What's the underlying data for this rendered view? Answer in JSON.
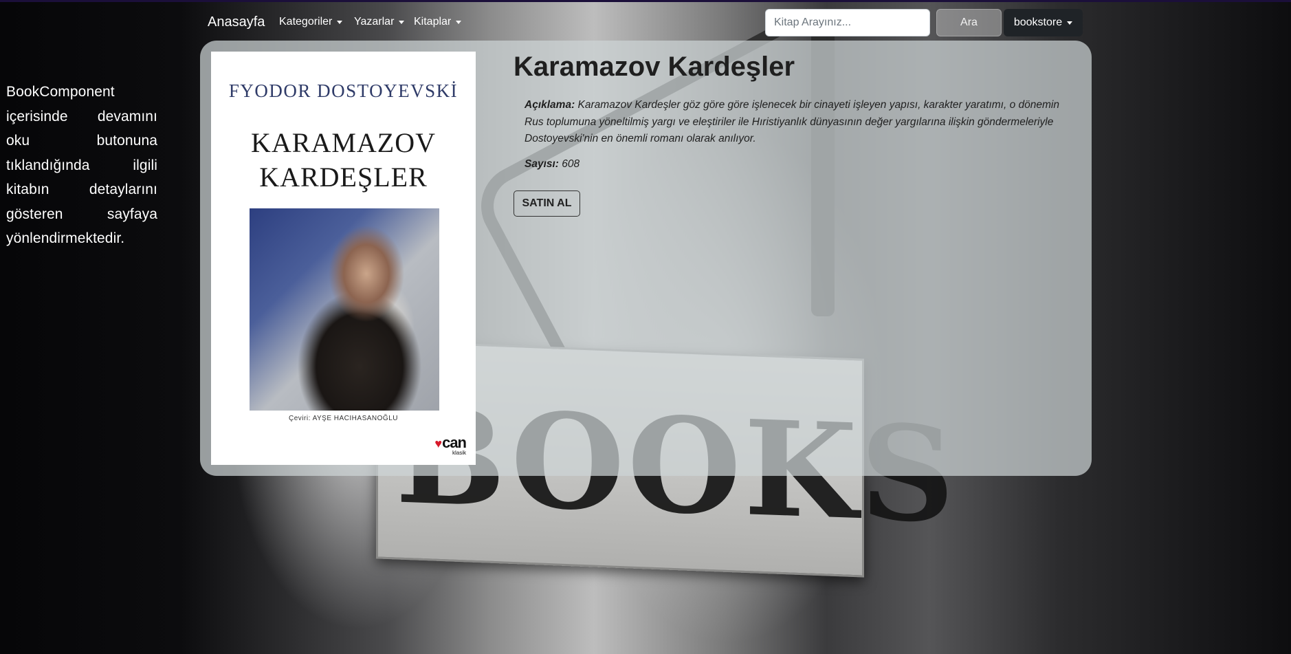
{
  "navbar": {
    "brand": "Anasayfa",
    "links": [
      {
        "label": "Kategoriler"
      },
      {
        "label": "Yazarlar"
      },
      {
        "label": "Kitaplar"
      }
    ],
    "search_placeholder": "Kitap Arayınız...",
    "search_button": "Ara",
    "user_menu": "bookstore"
  },
  "side_note": "BookComponent içerisinde devamını oku butonuna tıklandığında ilgili kitabın detaylarını gösteren sayfaya yönlendirmektedir.",
  "book": {
    "cover": {
      "author": "FYODOR DOSTOYEVSKİ",
      "title_line1": "KARAMAZOV",
      "title_line2": "KARDEŞLER",
      "translator": "Çeviri: AYŞE HACIHASANOĞLU",
      "publisher": "can",
      "series": "klasik"
    },
    "title": "Karamazov Kardeşler",
    "description_label": "Açıklama:",
    "description": "Karamazov Kardeşler göz göre göre işlenecek bir cinayeti işleyen yapısı, karakter yaratımı, o dönemin Rus toplumuna yöneltilmiş yargı ve eleştiriler ile Hıristiyanlık dünyasının değer yargılarına ilişkin göndermeleriyle Dostoyevski'nin en önemli romanı olarak anılıyor.",
    "pages_label": "Sayısı:",
    "pages": "608",
    "buy_button": "SATIN AL"
  },
  "background": {
    "sign_text": "BOOKS"
  },
  "colors": {
    "card_bg": "#cdd4d6",
    "user_btn": "#1f2327",
    "cover_author": "#2f3b68",
    "logo_heart": "#d7192a"
  }
}
